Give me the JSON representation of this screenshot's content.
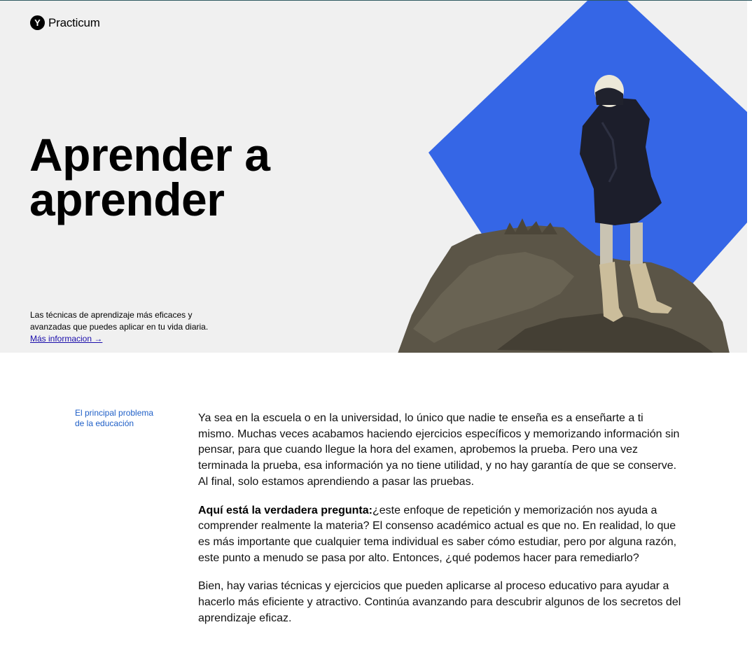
{
  "header": {
    "logo_mark": "Y",
    "logo_text": "Practicum"
  },
  "hero": {
    "title_line1": "Aprender a",
    "title_line2": "aprender",
    "subtitle": "Las técnicas de aprendizaje más eficaces y avanzadas que puedes aplicar en tu vida diaria.",
    "link_label": "Más informacion →",
    "accent_color": "#3566e6"
  },
  "section": {
    "side_label_line1": "El principal problema",
    "side_label_line2": "de la educación",
    "p1": "Ya sea en la escuela o en la universidad, lo único que nadie te enseña es a enseñarte a ti mismo. Muchas veces acabamos haciendo ejercicios específicos y memorizando información sin pensar, para que cuando llegue la hora del examen, aprobemos la prueba. Pero una vez terminada la prueba, esa información ya no tiene utilidad, y no hay garantía de que se conserve. Al final, solo estamos aprendiendo a pasar las pruebas.",
    "p2_bold": "Aquí está la verdadera pregunta:",
    "p2_rest": "¿este enfoque de repetición y memorización nos ayuda a comprender realmente la materia? El consenso académico actual es que no. En realidad, lo que es más importante que cualquier tema individual es saber cómo estudiar, pero por alguna razón, este punto a menudo se pasa por alto. Entonces, ¿qué podemos hacer para remediarlo?",
    "p3": "Bien, hay varias técnicas y ejercicios que pueden aplicarse al proceso educativo para ayudar a hacerlo más eficiente y atractivo. Continúa avanzando para descubrir algunos de los secretos del aprendizaje eficaz."
  }
}
